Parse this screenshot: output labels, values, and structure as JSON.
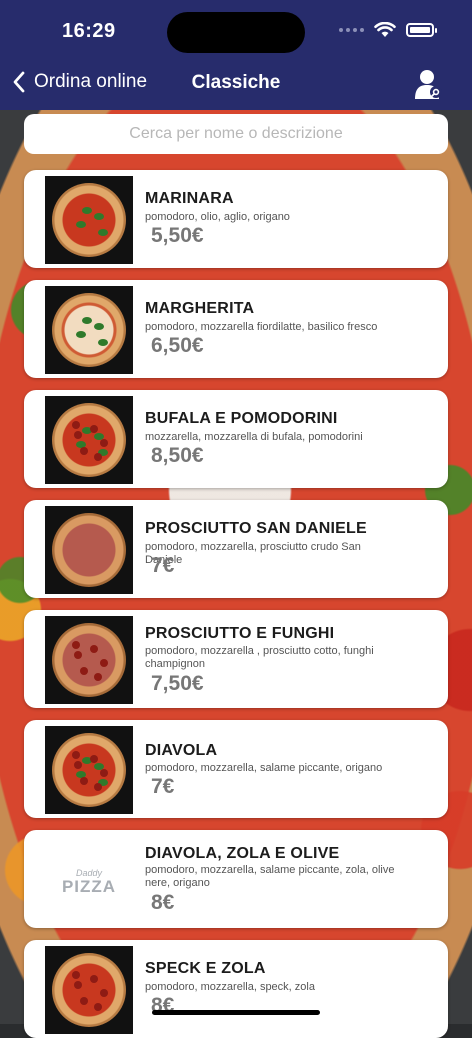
{
  "status_bar": {
    "time": "16:29"
  },
  "nav": {
    "back_label": "Ordina online",
    "title": "Classiche"
  },
  "search": {
    "placeholder": "Cerca per nome o descrizione"
  },
  "items": [
    {
      "name": "MARINARA",
      "description": "pomodoro, olio, aglio, origano",
      "price": "5,50€",
      "image": "pizza-marinara"
    },
    {
      "name": "MARGHERITA",
      "description": "pomodoro, mozzarella fiordilatte, basilico fresco",
      "price": "6,50€",
      "image": "pizza-margherita"
    },
    {
      "name": "BUFALA E POMODORINI",
      "description": "mozzarella, mozzarella di bufala, pomodorini",
      "price": "8,50€",
      "image": "pizza-bufala"
    },
    {
      "name": "PROSCIUTTO SAN DANIELE",
      "description": "pomodoro, mozzarella, prosciutto crudo San Daniele",
      "price": "7€",
      "image": "pizza-prosciutto"
    },
    {
      "name": "PROSCIUTTO E FUNGHI",
      "description": "pomodoro, mozzarella , prosciutto cotto, funghi champignon",
      "price": "7,50€",
      "image": "pizza-funghi"
    },
    {
      "name": "DIAVOLA",
      "description": "pomodoro, mozzarella, salame piccante, origano",
      "price": "7€",
      "image": "pizza-diavola"
    },
    {
      "name": "DIAVOLA, ZOLA E OLIVE",
      "description": "pomodoro, mozzarella, salame piccante, zola, olive nere, origano",
      "price": "8€",
      "image": "pizza-logo"
    },
    {
      "name": "SPECK E ZOLA",
      "description": "pomodoro, mozzarella, speck, zola",
      "price": "8€",
      "image": "pizza-speck"
    }
  ],
  "logo": {
    "script": "Daddy",
    "word": "PIZZA"
  }
}
